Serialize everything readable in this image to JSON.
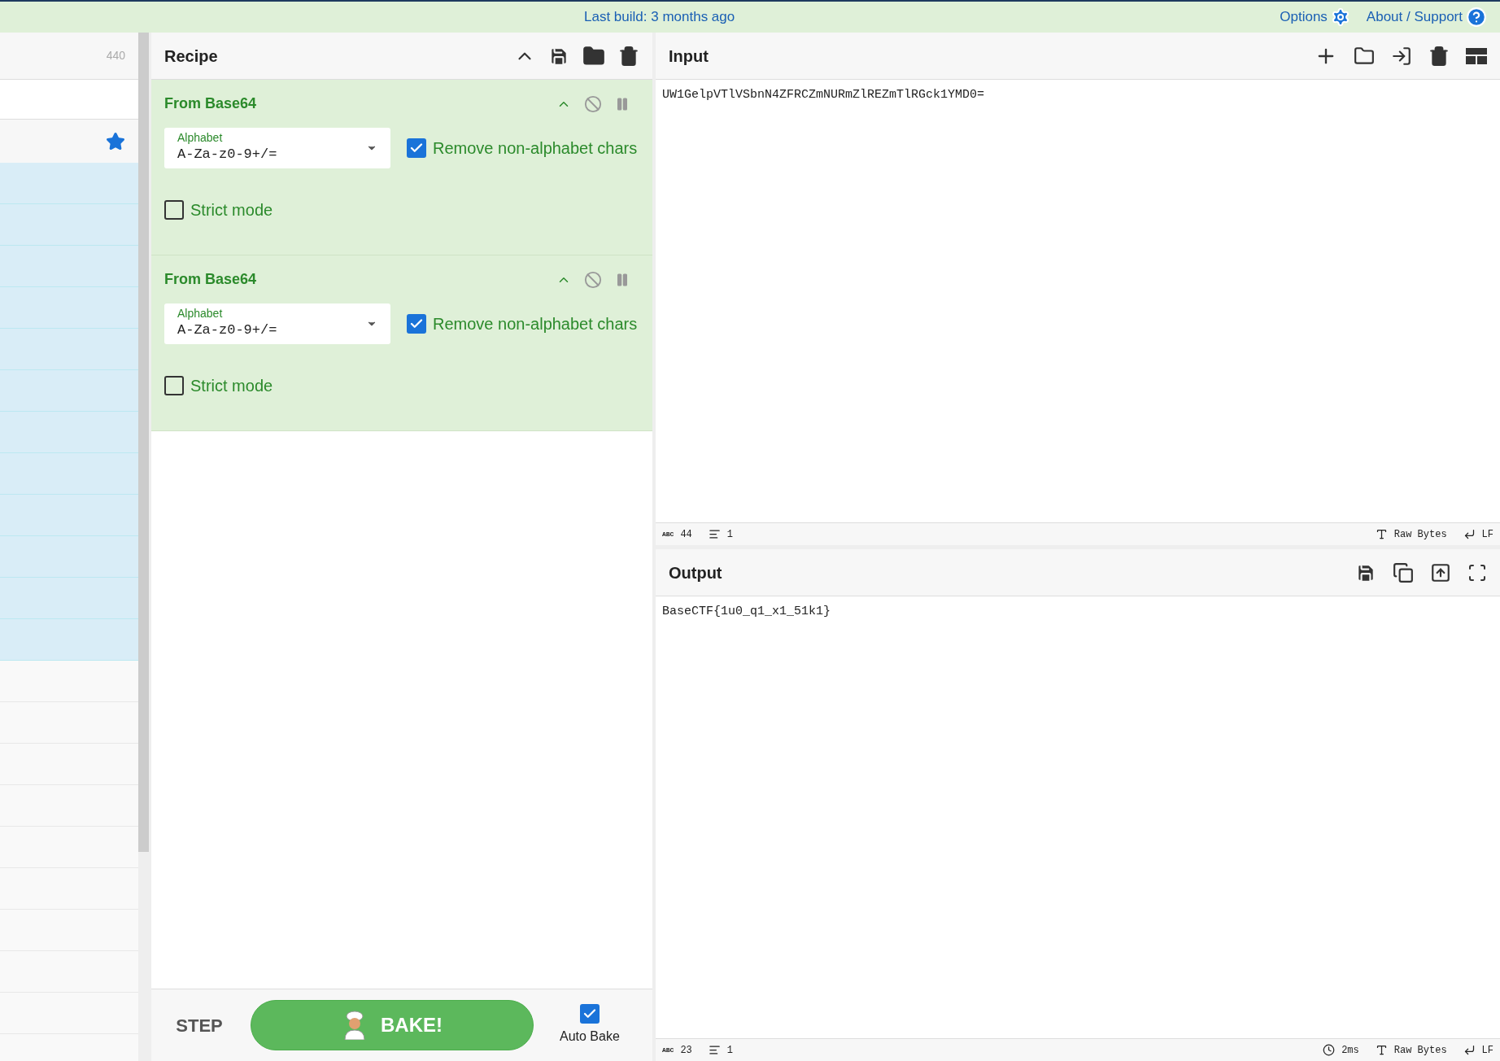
{
  "top_bar": {
    "build_notice": "Last build: 3 months ago",
    "links": [
      "Options",
      "About / Support"
    ]
  },
  "operations_panel": {
    "count": "440",
    "rows": [
      {
        "selected": true
      },
      {
        "selected": true
      },
      {
        "selected": true
      },
      {
        "selected": true
      },
      {
        "selected": true
      },
      {
        "selected": true
      },
      {
        "selected": true
      },
      {
        "selected": true
      },
      {
        "selected": true
      },
      {
        "selected": true
      },
      {
        "selected": true
      },
      {
        "selected": true
      },
      {
        "selected": false
      },
      {
        "selected": false
      },
      {
        "selected": false
      },
      {
        "selected": false
      },
      {
        "selected": false
      },
      {
        "selected": false
      },
      {
        "selected": false
      },
      {
        "selected": false
      },
      {
        "selected": false
      }
    ]
  },
  "recipe": {
    "title": "Recipe",
    "operations": [
      {
        "name": "From Base64",
        "alphabet_label": "Alphabet",
        "alphabet": "A-Za-z0-9+/=",
        "remove_non_alphabet": {
          "label": "Remove non-alphabet chars",
          "checked": true
        },
        "strict_mode": {
          "label": "Strict mode",
          "checked": false
        }
      },
      {
        "name": "From Base64",
        "alphabet_label": "Alphabet",
        "alphabet": "A-Za-z0-9+/=",
        "remove_non_alphabet": {
          "label": "Remove non-alphabet chars",
          "checked": true
        },
        "strict_mode": {
          "label": "Strict mode",
          "checked": false
        }
      }
    ],
    "step": "STEP",
    "bake": "BAKE!",
    "auto_bake": {
      "label": "Auto Bake",
      "checked": true
    }
  },
  "input": {
    "title": "Input",
    "text": "UW1GelpVTlVSbnN4ZFRCZmNURmZlREZmTlRGck1YMD0=",
    "status": {
      "length_mark": "ABC",
      "length": "44",
      "lines": "1",
      "encoding": "Raw Bytes",
      "eol": "LF"
    }
  },
  "output": {
    "title": "Output",
    "text": "BaseCTF{1u0_q1_x1_51k1}",
    "status": {
      "length_mark": "ABC",
      "length": "23",
      "lines": "1",
      "time": "2ms",
      "encoding": "Raw Bytes",
      "eol": "LF"
    }
  }
}
